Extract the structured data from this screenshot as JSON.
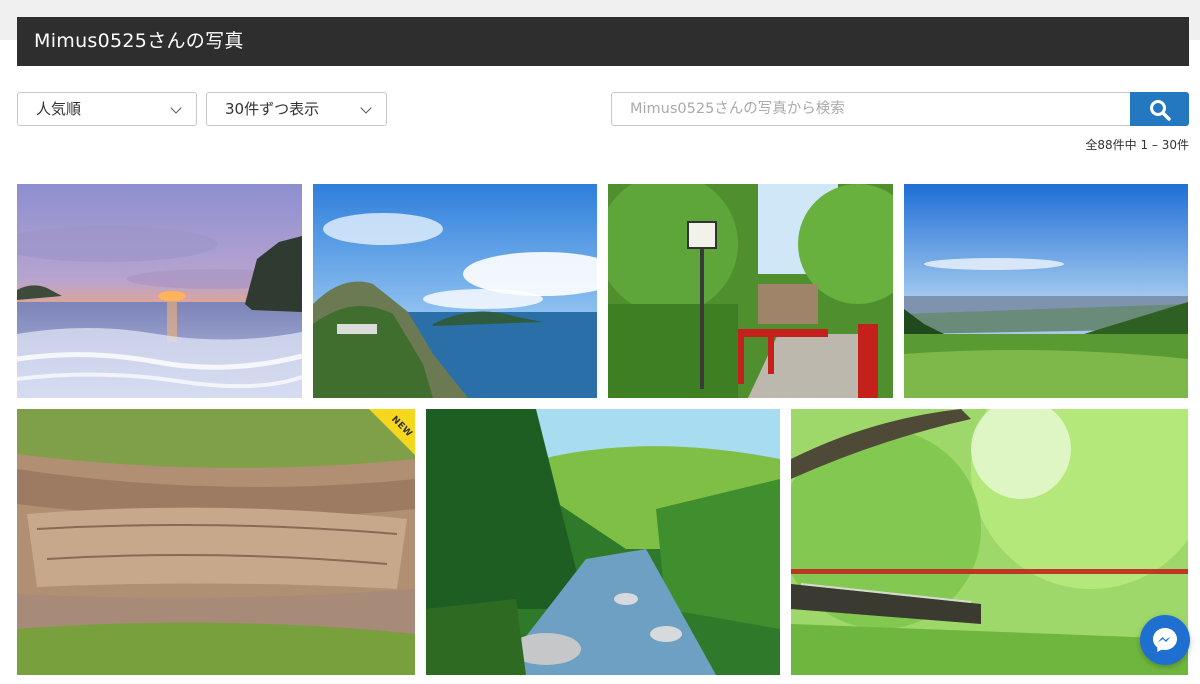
{
  "header": {
    "title": "Mimus0525さんの写真"
  },
  "toolbar": {
    "sort_value": "人気順",
    "perpage_value": "30件ずつ表示",
    "search_placeholder": "Mimus0525さんの写真から検索",
    "result_count": "全88件中 1 – 30件"
  },
  "photos": [
    {
      "subject": "sunset-sea"
    },
    {
      "subject": "sea-cliff"
    },
    {
      "subject": "red-bridge-lantern"
    },
    {
      "subject": "mountain-vista"
    },
    {
      "subject": "mossy-rock",
      "badge": "NEW"
    },
    {
      "subject": "mountain-stream"
    },
    {
      "subject": "green-maple-bridge"
    }
  ],
  "colors": {
    "header_bg": "#2e2e2e",
    "search_button": "#2478c0",
    "new_badge": "#f5d81e",
    "messenger": "#1f6fd1"
  },
  "icons": {
    "search": "search-icon",
    "messenger": "messenger-icon",
    "chevron": "chevron-down-icon"
  }
}
